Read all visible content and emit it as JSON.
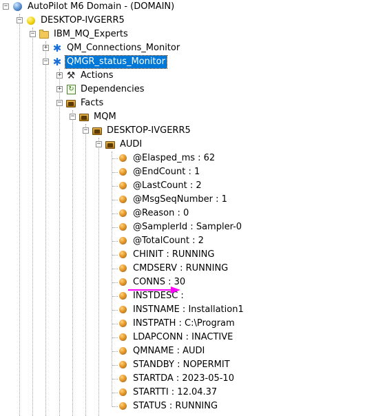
{
  "tree": {
    "root": {
      "label": "AutoPilot M6 Domain - (DOMAIN)",
      "icon": "globe-icon",
      "expander": "−"
    },
    "host": {
      "label": "DESKTOP-IVGERR5",
      "icon": "yellow-status-dot-icon",
      "expander": "−"
    },
    "group": {
      "label": "IBM_MQ_Experts",
      "icon": "folder-icon",
      "expander": "−"
    },
    "monitors": [
      {
        "label": "QM_Connections_Monitor",
        "icon": "monitor-icon",
        "expander": "+",
        "selected": false
      },
      {
        "label": "QMGR_status_Monitor",
        "icon": "monitor-icon",
        "expander": "−",
        "selected": true
      }
    ],
    "sections": [
      {
        "label": "Actions",
        "icon": "tools-icon",
        "expander": "+"
      },
      {
        "label": "Dependencies",
        "icon": "dependencies-icon",
        "expander": "+"
      },
      {
        "label": "Facts",
        "icon": "facts-folder-icon",
        "expander": "−"
      }
    ],
    "facts_path": [
      {
        "label": "MQM",
        "icon": "facts-folder-icon",
        "expander": "−"
      },
      {
        "label": "DESKTOP-IVGERR5",
        "icon": "facts-folder-icon",
        "expander": "−"
      },
      {
        "label": "AUDI",
        "icon": "facts-folder-icon",
        "expander": "−"
      }
    ],
    "facts": [
      "@Elasped_ms : 62",
      "@EndCount : 1",
      "@LastCount : 2",
      "@MsgSeqNumber : 1",
      "@Reason : 0",
      "@SamplerId : Sampler-0",
      "@TotalCount : 2",
      "CHINIT : RUNNING",
      "CMDSERV : RUNNING",
      "CONNS : 30",
      "INSTDESC :",
      "INSTNAME : Installation1",
      "INSTPATH : C:\\Program",
      "LDAPCONN : INACTIVE",
      "QMNAME : AUDI",
      "STANDBY : NOPERMIT",
      "STARTDA : 2023-05-10",
      "STARTTI : 12.04.37",
      "STATUS : RUNNING"
    ]
  },
  "annotation": {
    "color": "#ff00ff",
    "points_to": "CONNS : 30"
  },
  "colors": {
    "selection": "#0078d7",
    "guides": "#a0a0a0"
  }
}
